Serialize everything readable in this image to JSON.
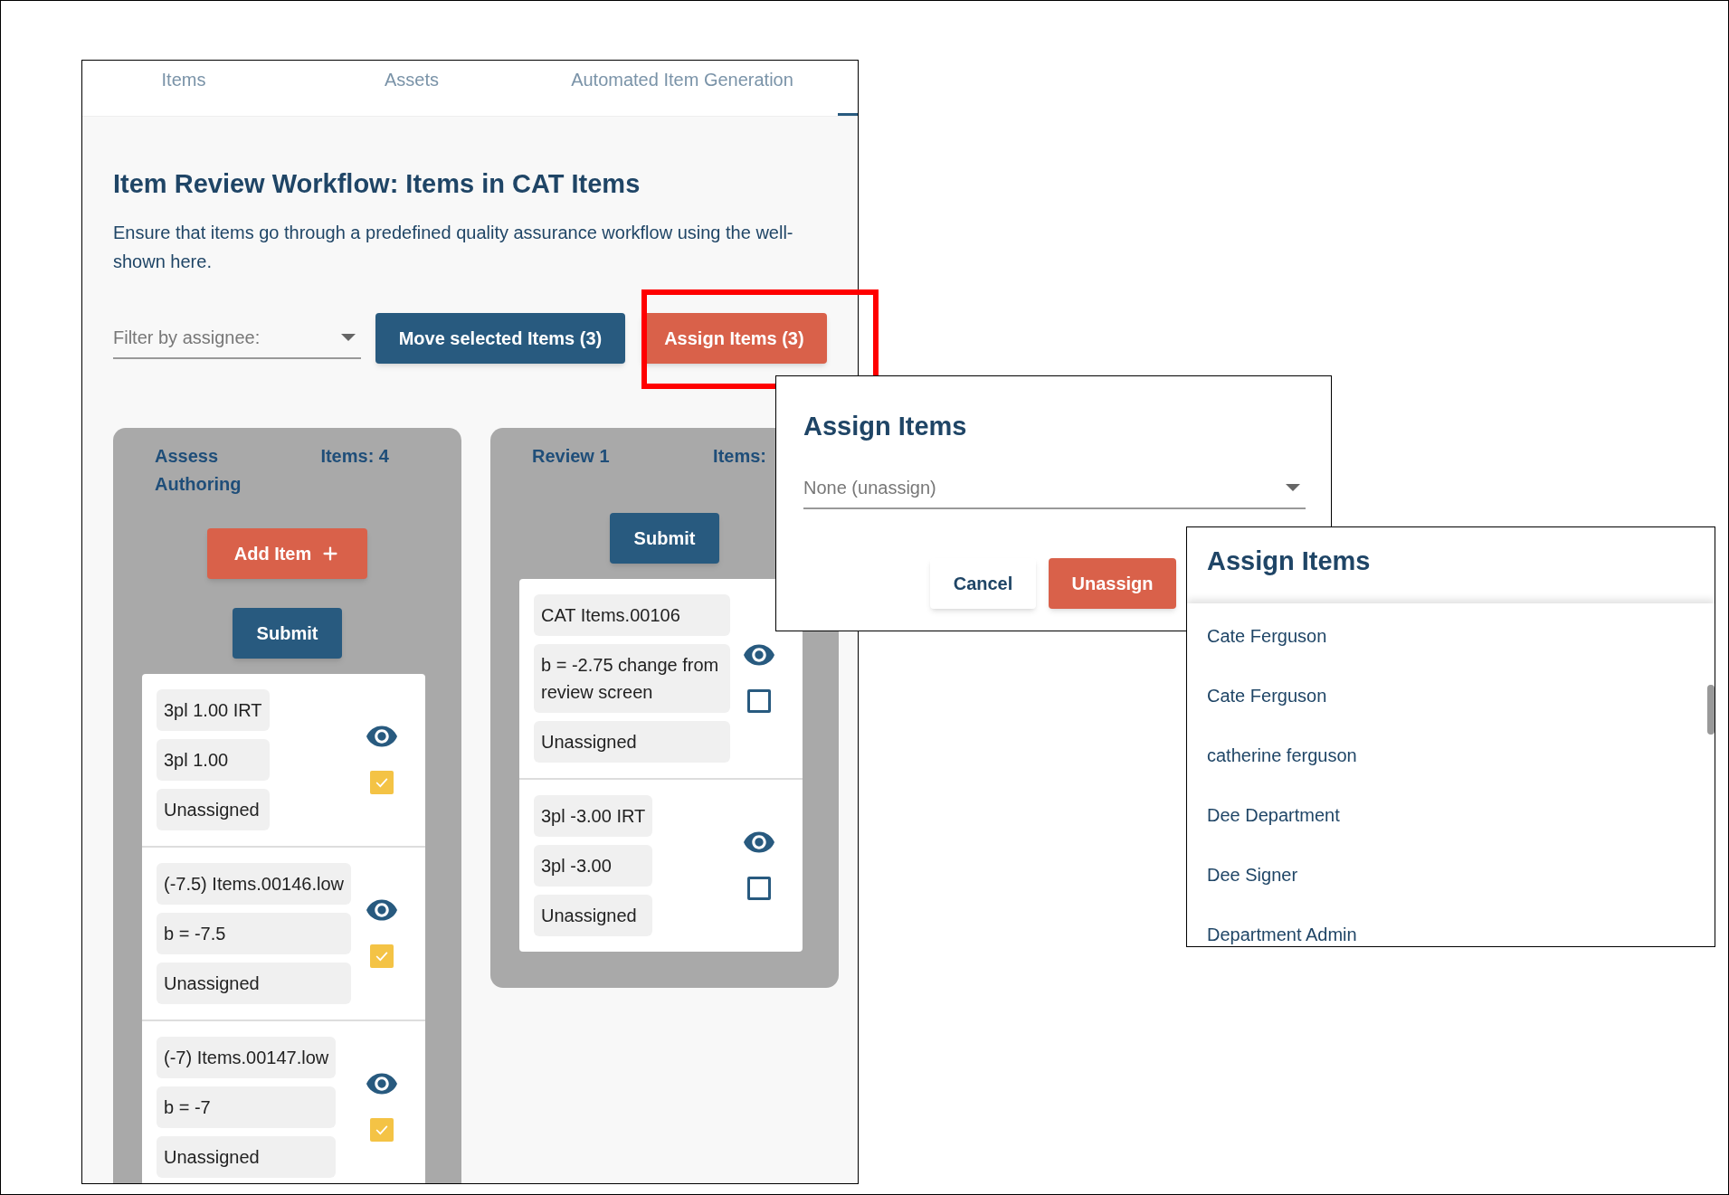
{
  "main_panel": {
    "tabs": [
      {
        "label": "Items",
        "selected": false
      },
      {
        "label": "Assets",
        "selected": false
      },
      {
        "label": "Automated Item Generation",
        "selected": false
      }
    ],
    "title": "Item Review Workflow: Items in CAT Items",
    "description_lines": [
      "Ensure that items go through a predefined quality assurance workflow using the well-",
      "shown here."
    ],
    "filter": {
      "placeholder": "Filter by assignee:"
    },
    "move_button": {
      "label": "Move selected Items (3)"
    },
    "assign_button": {
      "label": "Assign Items (3)",
      "highlighted": true
    },
    "columns": [
      {
        "name": "Assess Authoring",
        "count": "Items: 4",
        "actions": [
          {
            "kind": "add",
            "label": "Add Item"
          },
          {
            "kind": "submit",
            "label": "Submit"
          }
        ],
        "cards": [
          {
            "lines": [
              "3pl 1.00 IRT",
              "3pl 1.00",
              "Unassigned"
            ],
            "checked": true
          },
          {
            "lines": [
              "(-7.5) Items.00146.low",
              "b = -7.5",
              "Unassigned"
            ],
            "checked": true
          },
          {
            "lines": [
              "(-7) Items.00147.low",
              "b = -7",
              "Unassigned"
            ],
            "checked": true
          }
        ]
      },
      {
        "name": "Review 1",
        "count": "Items:",
        "actions": [
          {
            "kind": "submit",
            "label": "Submit"
          }
        ],
        "cards": [
          {
            "lines": [
              "CAT Items.00106",
              "b = -2.75 change from review screen",
              "Unassigned"
            ],
            "checked": false
          },
          {
            "lines": [
              "3pl -3.00 IRT",
              "3pl -3.00",
              "Unassigned"
            ],
            "checked": false
          }
        ]
      }
    ]
  },
  "assign_dialog": {
    "title": "Assign Items",
    "value": "None (unassign)",
    "buttons": [
      {
        "kind": "secondary",
        "label": "Cancel"
      },
      {
        "kind": "primary",
        "label": "Unassign"
      }
    ]
  },
  "assign_dropdown": {
    "title": "Assign Items",
    "options": [
      "Cate Ferguson",
      "Cate Ferguson",
      "catherine ferguson",
      "Dee Department",
      "Dee Signer",
      "Department Admin"
    ]
  }
}
